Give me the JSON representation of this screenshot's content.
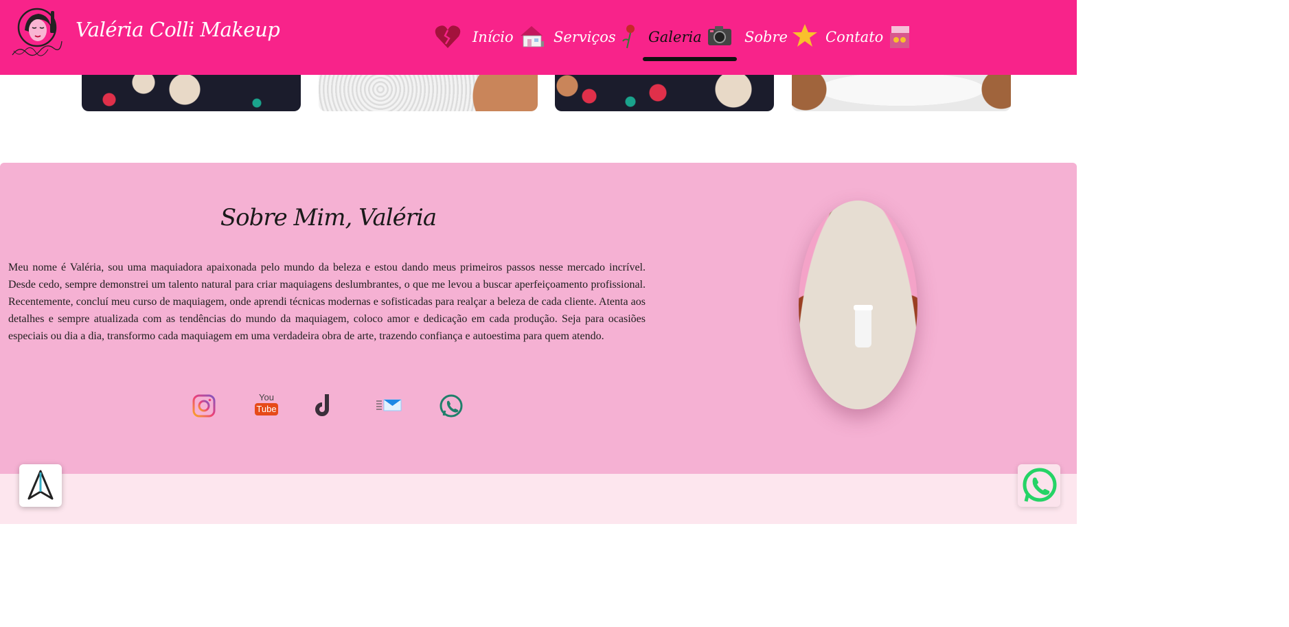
{
  "header": {
    "brand": "Valéria Colli Makeup",
    "nav": [
      {
        "label": "Início",
        "icon": "house-icon"
      },
      {
        "label": "Serviços",
        "icon": "rose-icon"
      },
      {
        "label": "Galeria",
        "icon": "camera-icon",
        "active": true
      },
      {
        "label": "Sobre",
        "icon": "star-icon"
      },
      {
        "label": "Contato",
        "icon": "contact-card-icon"
      }
    ]
  },
  "about": {
    "title": "Sobre Mim, Valéria",
    "text": "Meu nome é Valéria, sou uma maquiadora apaixonada pelo mundo da beleza e estou dando meus primeiros passos nesse mercado incrível. Desde cedo, sempre demonstrei um talento natural para criar maquiagens deslumbrantes, o que me levou a buscar aperfeiçoamento profissional. Recentemente, concluí meu curso de maquiagem, onde aprendi técnicas modernas e sofisticadas para realçar a beleza de cada cliente. Atenta aos detalhes e sempre atualizada com as tendências do mundo da maquiagem, coloco amor e dedicação em cada produção. Seja para ocasiões especiais ou dia a dia, transformo cada maquiagem em uma verdadeira obra de arte, trazendo confiança e autoestima para quem atendo.",
    "socials": [
      "instagram-icon",
      "youtube-icon",
      "tiktok-icon",
      "email-icon",
      "whatsapp-icon"
    ],
    "youtube_top": "You",
    "youtube_bottom": "Tube"
  },
  "colors": {
    "header_bg": "#f8238a",
    "about_bg": "#f5b1d3",
    "bottom_bg": "#fde6ee"
  }
}
